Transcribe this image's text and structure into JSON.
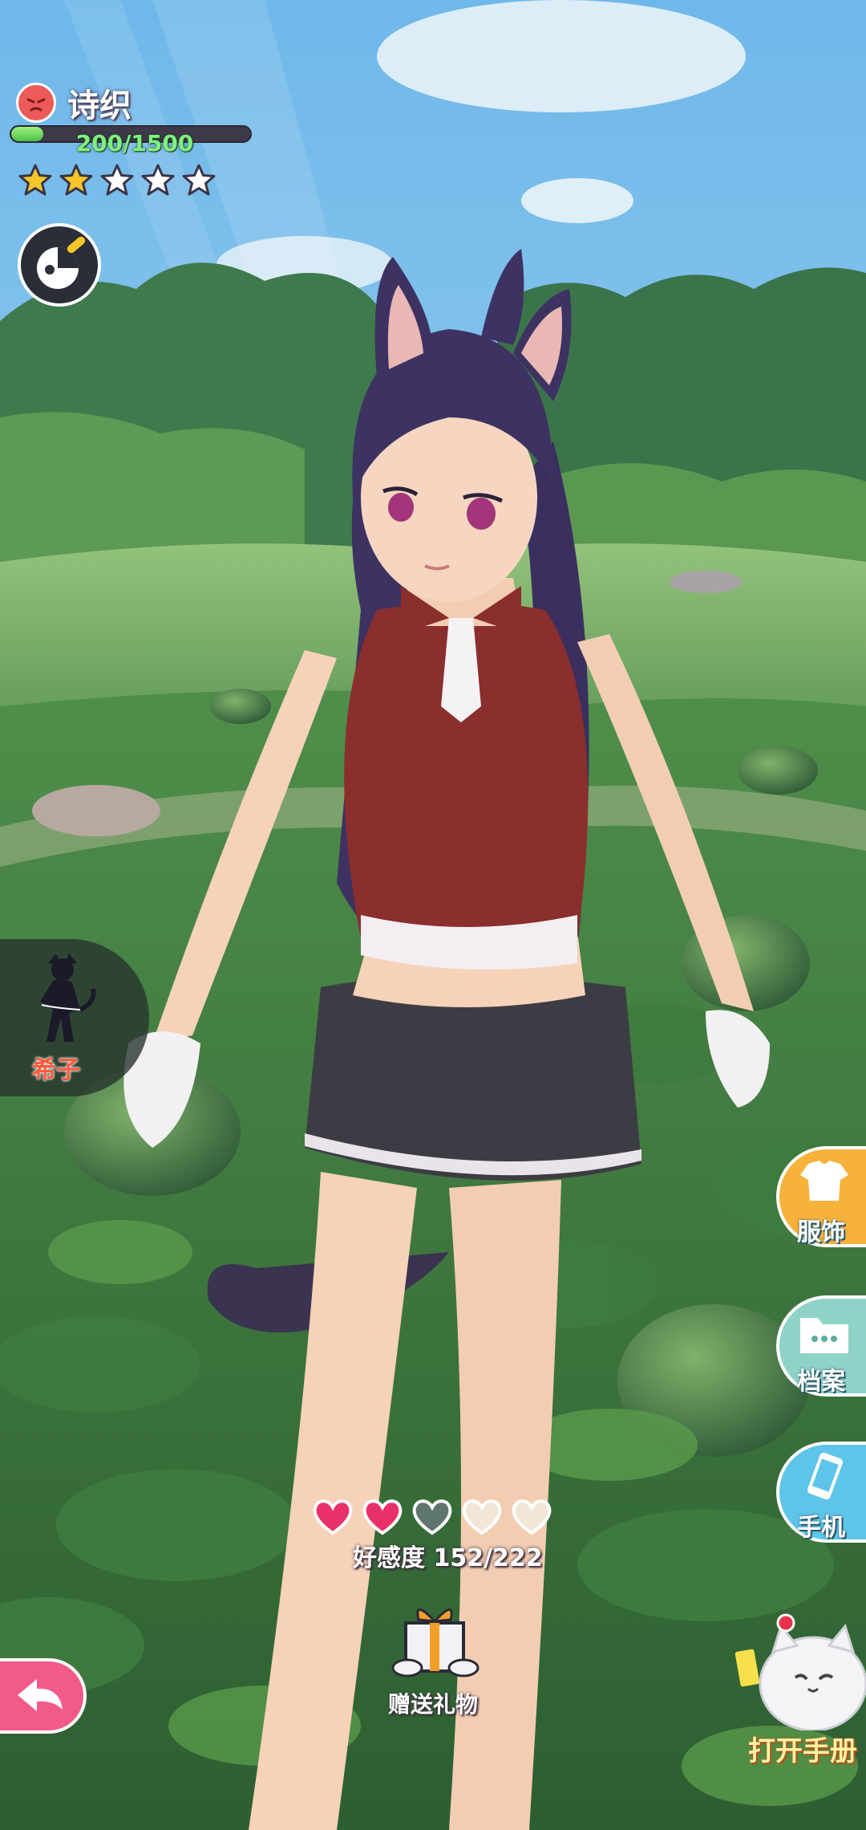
{
  "character": {
    "name": "诗织",
    "mood_icon": "angry-face-icon",
    "exp_text": "200/1500",
    "exp_progress": 0.1333,
    "stars_filled": 2,
    "stars_total": 5
  },
  "left_tab": {
    "label": "希子",
    "icon": "character-silhouette-icon"
  },
  "side_buttons": [
    {
      "label": "服饰",
      "icon": "clothes-icon",
      "color": "#f7b23b"
    },
    {
      "label": "档案",
      "icon": "folder-icon",
      "color": "#8fd3c8"
    },
    {
      "label": "手机",
      "icon": "phone-icon",
      "color": "#5fc4ea"
    }
  ],
  "affection": {
    "label": "好感度",
    "value": "152/222",
    "hearts_filled": 2,
    "hearts_total": 5
  },
  "gift": {
    "label": "赠送礼物"
  },
  "handbook": {
    "label": "打开手册"
  },
  "colors": {
    "heart_filled": "#e8316a",
    "heart_empty": "#f3e6d6",
    "exp_fill": "#5fd35a",
    "star": "#f6c62a"
  }
}
